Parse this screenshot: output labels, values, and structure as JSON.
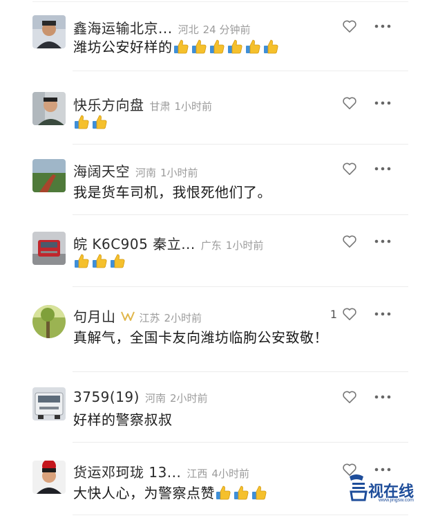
{
  "comments": [
    {
      "username": "鑫海运输北京...",
      "region": "河北",
      "time": "24 分钟前",
      "text": "潍坊公安好样的",
      "thumbs_count": 6,
      "likes": ""
    },
    {
      "username": "快乐方向盘",
      "region": "甘肃",
      "time": "1小时前",
      "text": "",
      "thumbs_count": 2,
      "likes": ""
    },
    {
      "username": "海阔天空",
      "region": "河南",
      "time": "1小时前",
      "text": "我是货车司机，我恨死他们了。",
      "thumbs_count": 0,
      "likes": ""
    },
    {
      "username": "皖 K6C905 秦立...",
      "region": "广东",
      "time": "1小时前",
      "text": "",
      "thumbs_count": 3,
      "likes": ""
    },
    {
      "username": "句月山",
      "region": "江苏",
      "time": "2小时前",
      "text": "真解气，全国卡友向潍坊临朐公安致敬！",
      "thumbs_count": 0,
      "likes": "1"
    },
    {
      "username": "3759(19)",
      "region": "河南",
      "time": "2小时前",
      "text": "好样的警察叔叔",
      "thumbs_count": 0,
      "likes": ""
    },
    {
      "username": "货运邓珂珑 13...",
      "region": "江西",
      "time": "4小时前",
      "text": "大快人心，为警察点赞",
      "thumbs_count": 3,
      "likes": ""
    }
  ],
  "icons": {
    "like": "heart-outline-icon",
    "more": "more-horizontal-icon",
    "thumb": "thumbs-up-emoji"
  },
  "colors": {
    "meta": "#9b9b9b",
    "divider": "#ececec",
    "watermark": "#1e4d9a"
  },
  "watermark": {
    "name": "视在线",
    "url": "www.jingsw.com"
  }
}
